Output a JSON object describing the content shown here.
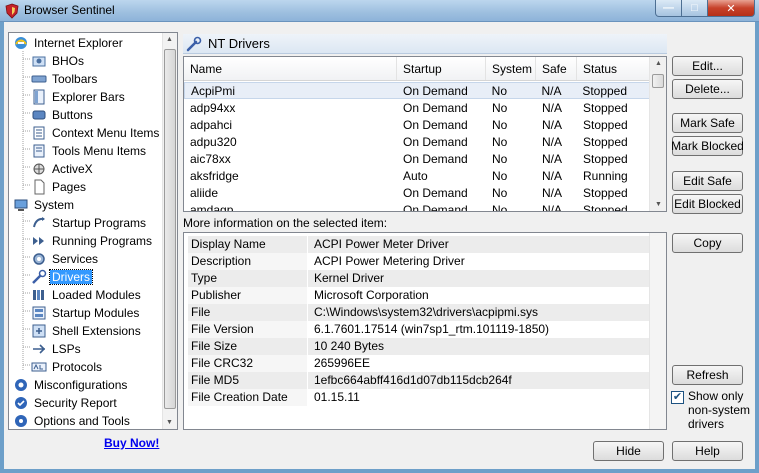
{
  "window": {
    "title": "Browser Sentinel"
  },
  "tree": {
    "items": [
      {
        "label": "Internet Explorer",
        "level": 0,
        "icon": "internet-explorer-icon"
      },
      {
        "label": "BHOs",
        "level": 1,
        "icon": "bho-icon"
      },
      {
        "label": "Toolbars",
        "level": 1,
        "icon": "toolbar-icon"
      },
      {
        "label": "Explorer Bars",
        "level": 1,
        "icon": "explorer-bar-icon"
      },
      {
        "label": "Buttons",
        "level": 1,
        "icon": "button-icon"
      },
      {
        "label": "Context Menu Items",
        "level": 1,
        "icon": "context-menu-icon"
      },
      {
        "label": "Tools Menu Items",
        "level": 1,
        "icon": "tools-menu-icon"
      },
      {
        "label": "ActiveX",
        "level": 1,
        "icon": "activex-icon"
      },
      {
        "label": "Pages",
        "level": 1,
        "icon": "page-icon"
      },
      {
        "label": "System",
        "level": 0,
        "icon": "system-icon"
      },
      {
        "label": "Startup Programs",
        "level": 1,
        "icon": "startup-programs-icon"
      },
      {
        "label": "Running Programs",
        "level": 1,
        "icon": "running-programs-icon"
      },
      {
        "label": "Services",
        "level": 1,
        "icon": "services-icon"
      },
      {
        "label": "Drivers",
        "level": 1,
        "icon": "drivers-icon",
        "selected": true
      },
      {
        "label": "Loaded Modules",
        "level": 1,
        "icon": "loaded-modules-icon"
      },
      {
        "label": "Startup Modules",
        "level": 1,
        "icon": "startup-modules-icon"
      },
      {
        "label": "Shell Extensions",
        "level": 1,
        "icon": "shell-extensions-icon"
      },
      {
        "label": "LSPs",
        "level": 1,
        "icon": "lsp-icon"
      },
      {
        "label": "Protocols",
        "level": 1,
        "icon": "protocols-icon"
      },
      {
        "label": "Misconfigurations",
        "level": 0,
        "icon": "misconfigurations-icon"
      },
      {
        "label": "Security Report",
        "level": 0,
        "icon": "security-report-icon"
      },
      {
        "label": "Options and Tools",
        "level": 0,
        "icon": "options-tools-icon"
      }
    ],
    "buy_now": "Buy Now!"
  },
  "section": {
    "title": "NT Drivers"
  },
  "drivers": {
    "columns": [
      "Name",
      "Startup",
      "System",
      "Safe",
      "Status"
    ],
    "rows": [
      [
        "AcpiPmi",
        "On Demand",
        "No",
        "N/A",
        "Stopped"
      ],
      [
        "adp94xx",
        "On Demand",
        "No",
        "N/A",
        "Stopped"
      ],
      [
        "adpahci",
        "On Demand",
        "No",
        "N/A",
        "Stopped"
      ],
      [
        "adpu320",
        "On Demand",
        "No",
        "N/A",
        "Stopped"
      ],
      [
        "aic78xx",
        "On Demand",
        "No",
        "N/A",
        "Stopped"
      ],
      [
        "aksfridge",
        "Auto",
        "No",
        "N/A",
        "Running"
      ],
      [
        "aliide",
        "On Demand",
        "No",
        "N/A",
        "Stopped"
      ],
      [
        "amdagp",
        "On Demand",
        "No",
        "N/A",
        "Stopped"
      ]
    ]
  },
  "more_info": {
    "label": "More information on the selected item:",
    "rows": [
      [
        "Display Name",
        "ACPI Power Meter Driver"
      ],
      [
        "Description",
        "ACPI Power Metering Driver"
      ],
      [
        "Type",
        "Kernel Driver"
      ],
      [
        "Publisher",
        "Microsoft Corporation"
      ],
      [
        "File",
        "C:\\Windows\\system32\\drivers\\acpipmi.sys"
      ],
      [
        "File Version",
        "6.1.7601.17514 (win7sp1_rtm.101119-1850)"
      ],
      [
        "File Size",
        "10 240 Bytes"
      ],
      [
        "File CRC32",
        "265996EE"
      ],
      [
        "File MD5",
        "1efbc664abff416d1d07db115dcb264f"
      ],
      [
        "File Creation Date",
        "01.15.11"
      ]
    ]
  },
  "buttons": {
    "edit": "Edit...",
    "delete": "Delete...",
    "mark_safe": "Mark Safe",
    "mark_blocked": "Mark Blocked",
    "edit_safe": "Edit Safe",
    "edit_blocked": "Edit Blocked",
    "copy": "Copy",
    "refresh": "Refresh",
    "show_only_label": "Show only non-system drivers",
    "show_only_checked": true,
    "hide": "Hide",
    "help": "Help"
  },
  "colors": {
    "selection": "#3399ff",
    "link": "#0000ee",
    "titlebar": "#9dbfdf"
  }
}
